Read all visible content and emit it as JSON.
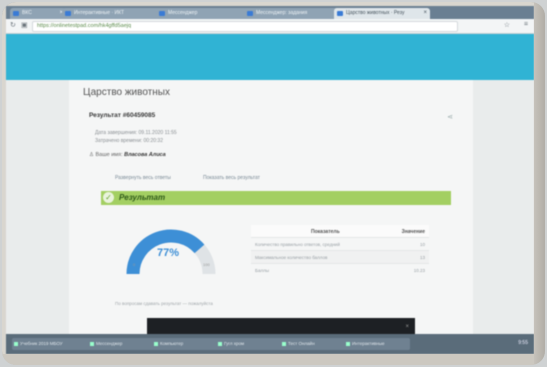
{
  "browser": {
    "tabs": [
      {
        "label": "ВКС"
      },
      {
        "label": "Интерактивные · ИКТ"
      },
      {
        "label": "Мессенджер"
      },
      {
        "label": "Мессенджер: задания"
      },
      {
        "label": "Царство животных · Резу"
      }
    ],
    "url": "https://onlinetestpad.com/hk4gffd5aejq"
  },
  "page": {
    "title": "Царство животных",
    "result_id": "Результат #60459085",
    "date_line": "Дата завершения: 09.11.2020 11:55",
    "time_line": "Затрачено времени: 00:20:32",
    "name_label": "Ваше имя:",
    "name_value": "Власова Алиса",
    "link_left": "Развернуть весь ответы",
    "link_right": "Показать весь результат",
    "result_label": "Результат",
    "gauge": {
      "value_label": "77%",
      "value": 77,
      "min_label": "0",
      "max_label": "100"
    },
    "table": {
      "header_metric": "Показатель",
      "header_value": "Значение",
      "rows": [
        {
          "metric": "Количество правильно ответов, средний",
          "value": "10"
        },
        {
          "metric": "Максимальное количество баллов",
          "value": "13"
        },
        {
          "metric": "Баллы",
          "value": "10.23"
        }
      ]
    },
    "note": "По вопросам сдавать результат — пожалуйста"
  },
  "taskbar": {
    "items": [
      "Учебник 2019 МБОУ",
      "Мессенджер",
      "Компьютер",
      "Гугл хром",
      "Тест Онлайн",
      "Интерактивные"
    ],
    "time": "9:55"
  },
  "colors": {
    "header": "#30b3d4",
    "result_bar": "#a3cf62",
    "gauge": "#3d8fd6"
  }
}
